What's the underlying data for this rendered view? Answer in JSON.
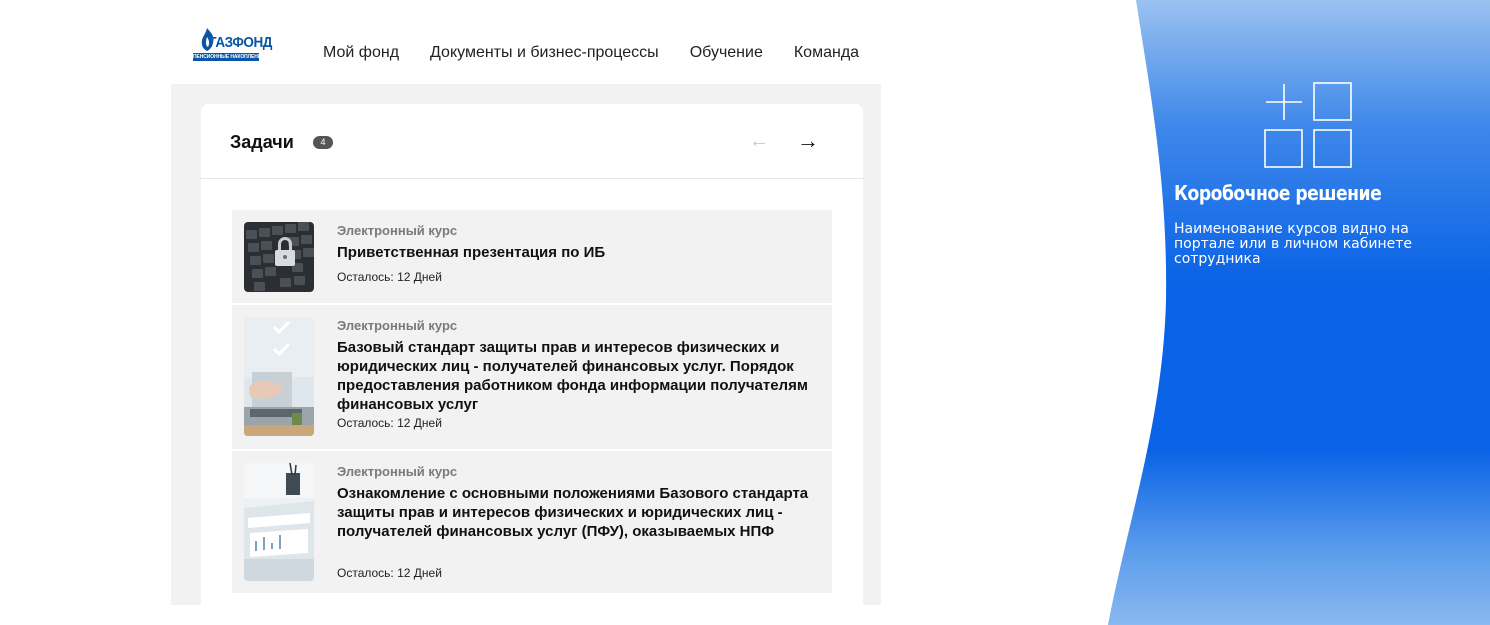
{
  "logo": {
    "brand": "ГАЗФОНД",
    "sub": "ПЕНСИОННЫЕ НАКОПЛЕНИЯ"
  },
  "nav": {
    "items": [
      "Мой фонд",
      "Документы и бизнес-процессы",
      "Обучение",
      "Команда"
    ]
  },
  "tasks_card": {
    "title": "Задачи",
    "count": "4",
    "prev_arrow": "←",
    "next_arrow": "→",
    "items": [
      {
        "type": "Электронный курс",
        "title": "Приветственная презентация по ИБ",
        "remaining": "Осталось: 12 Дней"
      },
      {
        "type": "Электронный курс",
        "title": "Базовый стандарт защиты прав и интересов физических и юридических лиц - получателей финансовых услуг. Порядок предоставления работником фонда информации получателям финансовых услуг",
        "remaining": "Осталось: 12 Дней"
      },
      {
        "type": "Электронный курс",
        "title": "Ознакомление с основными положениями Базового стандарта защиты прав и интересов физических и юридических лиц - получателей финансовых услуг (ПФУ), оказываемых НПФ",
        "remaining": "Осталось: 12 Дней"
      }
    ]
  },
  "banner": {
    "title": "Коробочное решение",
    "description": "Наименование курсов видно на портале или в личном кабинете сотрудника",
    "icon": "boxes-plus-icon",
    "colors": {
      "top": "#9bc2f0",
      "middle": "#0a63e6",
      "bottom": "#8ab8ef"
    }
  }
}
